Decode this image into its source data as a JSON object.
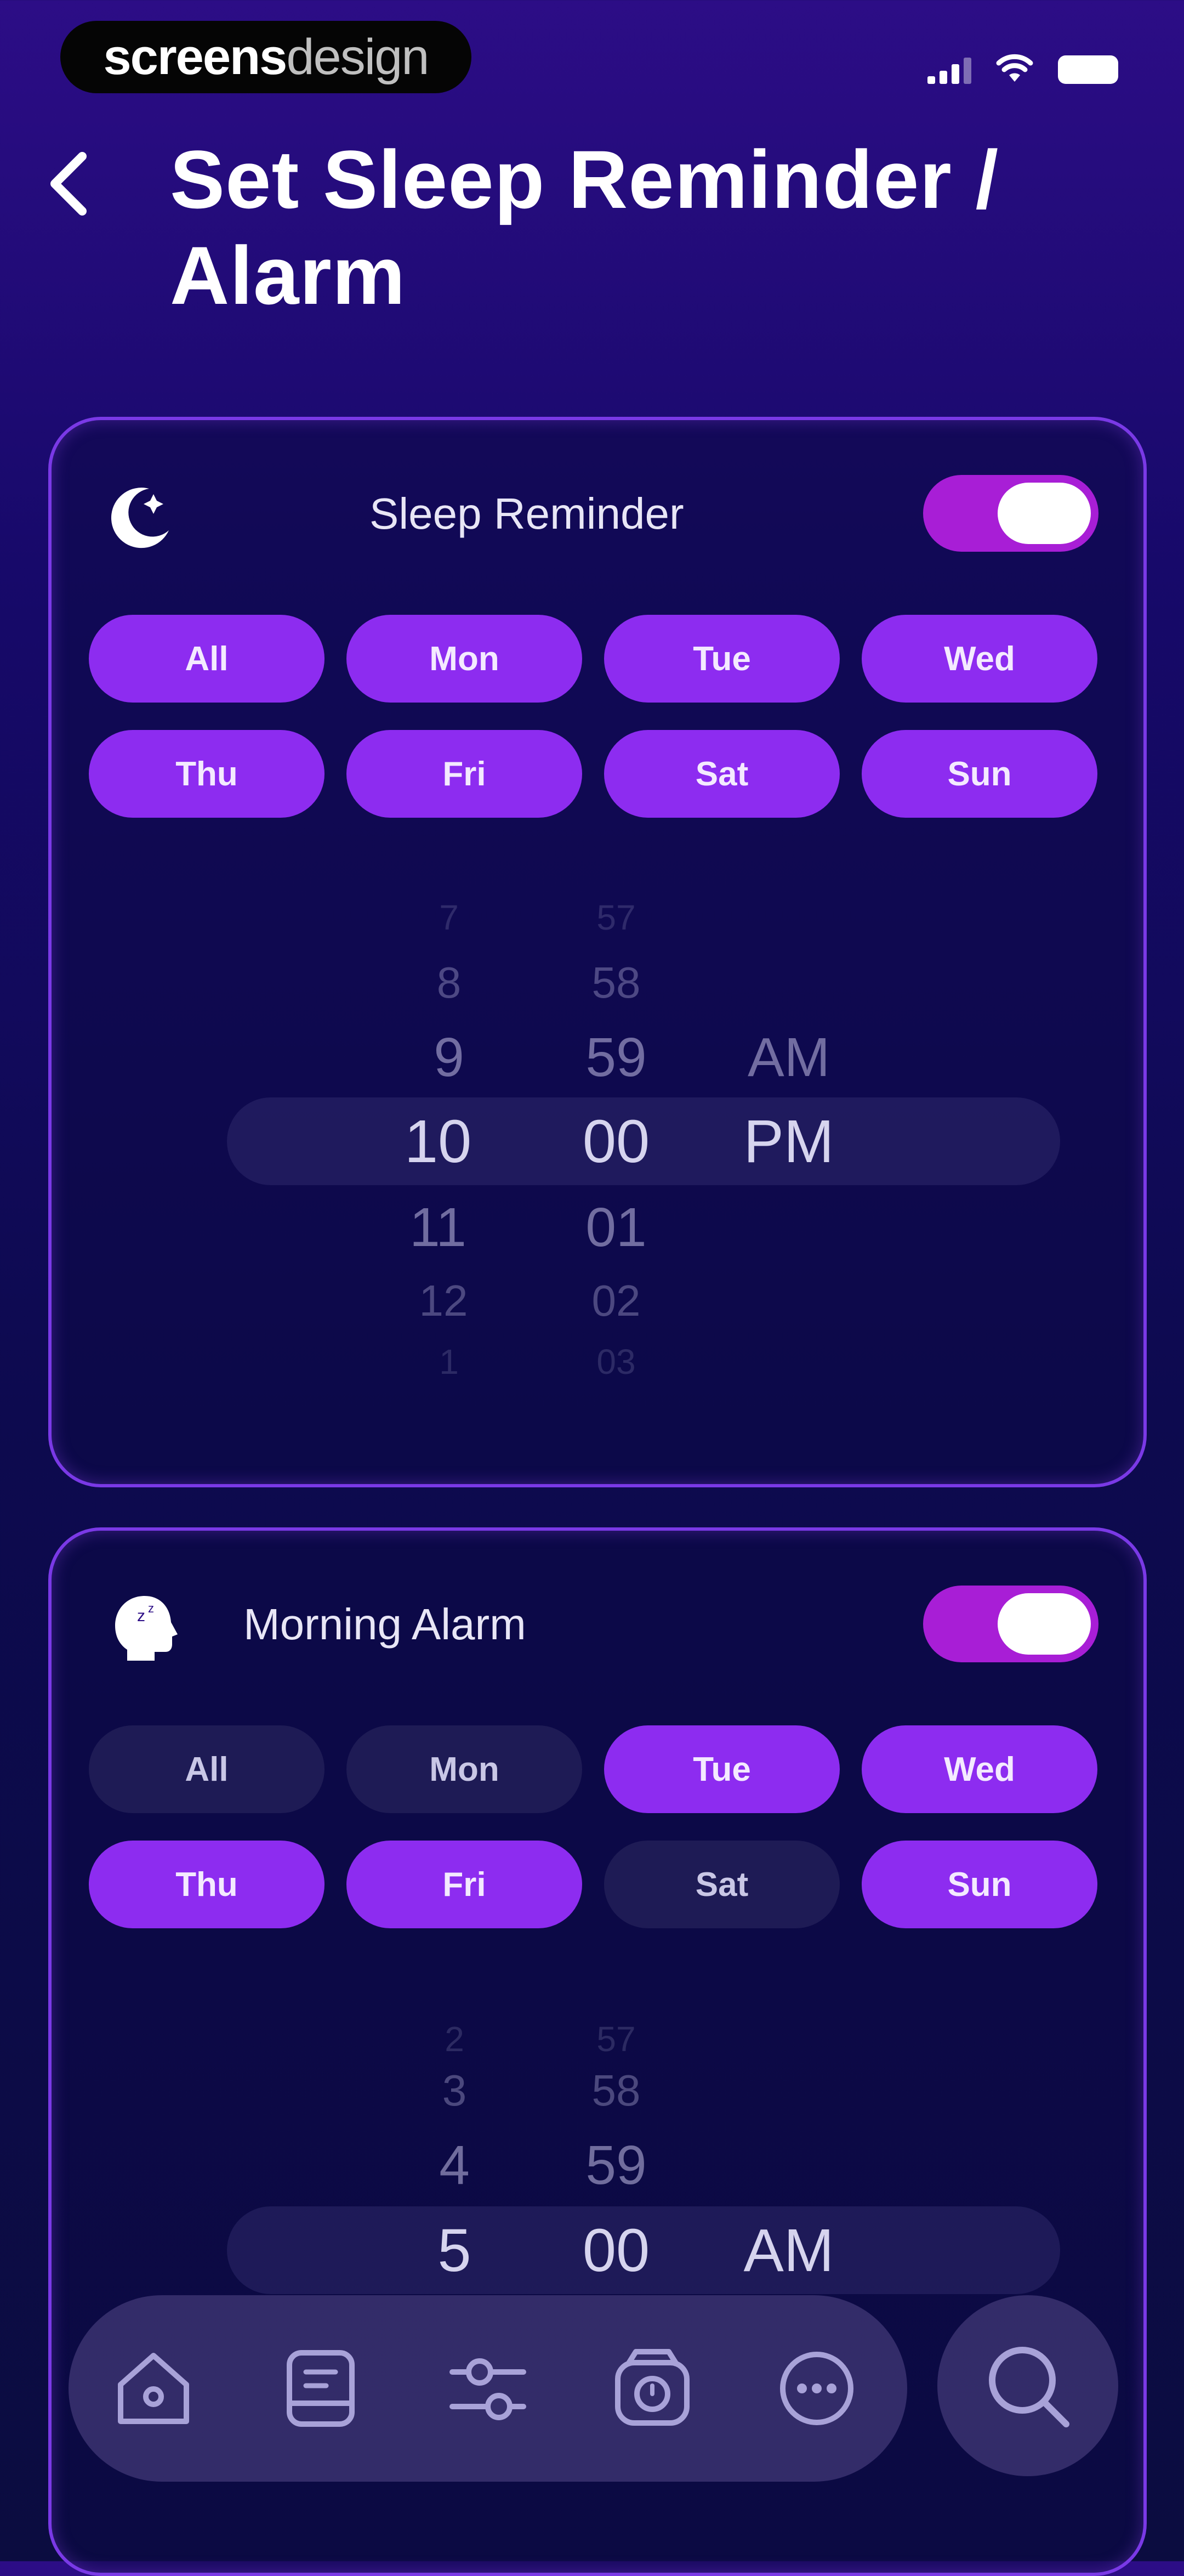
{
  "status_bar": {
    "brand_strong": "screens",
    "brand_light": "design"
  },
  "header": {
    "title_line1": "Set Sleep Reminder /",
    "title_line2": "Alarm"
  },
  "sleep_reminder": {
    "label": "Sleep Reminder",
    "enabled": true,
    "days": [
      {
        "label": "All",
        "on": true
      },
      {
        "label": "Mon",
        "on": true
      },
      {
        "label": "Tue",
        "on": true
      },
      {
        "label": "Wed",
        "on": true
      },
      {
        "label": "Thu",
        "on": true
      },
      {
        "label": "Fri",
        "on": true
      },
      {
        "label": "Sat",
        "on": true
      },
      {
        "label": "Sun",
        "on": true
      }
    ],
    "hours_above": [
      "7",
      "8",
      "9"
    ],
    "hour": "10",
    "hours_below": [
      "11",
      "12",
      "1"
    ],
    "minutes_above": [
      "57",
      "58",
      "59"
    ],
    "minute": "00",
    "minutes_below": [
      "01",
      "02",
      "03"
    ],
    "period_above": "AM",
    "period": "PM"
  },
  "morning_alarm": {
    "label": "Morning Alarm",
    "enabled": true,
    "days": [
      {
        "label": "All",
        "on": false
      },
      {
        "label": "Mon",
        "on": false
      },
      {
        "label": "Tue",
        "on": true
      },
      {
        "label": "Wed",
        "on": true
      },
      {
        "label": "Thu",
        "on": true
      },
      {
        "label": "Fri",
        "on": true
      },
      {
        "label": "Sat",
        "on": false
      },
      {
        "label": "Sun",
        "on": true
      }
    ],
    "hours_above": [
      "2",
      "3",
      "4"
    ],
    "hour": "5",
    "minutes_above": [
      "57",
      "58",
      "59"
    ],
    "minute": "00",
    "period": "AM"
  },
  "nav": {
    "icons": [
      "home-icon",
      "journal-icon",
      "adjust-icon",
      "alarm-clock-icon",
      "more-icon"
    ],
    "search_icon": "search-icon"
  },
  "colors": {
    "accent": "#8d2cf0",
    "toggle": "#a81ed6",
    "card_border": "#7a39e6",
    "bg_top": "#2c0d86",
    "bg_bottom": "#0b0c40"
  }
}
